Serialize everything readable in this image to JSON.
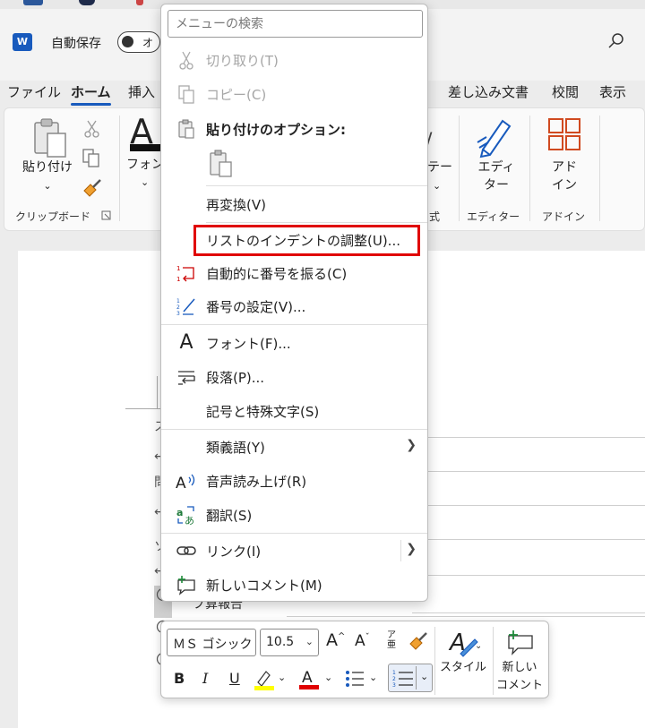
{
  "titlebar": {
    "app_logo": "W",
    "autosave_label": "自動保存",
    "autosave_toggle_text": "オ"
  },
  "tabs": [
    {
      "label": "ファイル",
      "active": false
    },
    {
      "label": "ホーム",
      "active": true
    },
    {
      "label": "挿入",
      "active": false
    },
    {
      "label": "差し込み文書",
      "active": false
    },
    {
      "label": "校閲",
      "active": false
    },
    {
      "label": "表示",
      "active": false
    }
  ],
  "ribbon": {
    "paste_label": "貼り付け",
    "clipboard_group": "クリップボード",
    "font_label": "フォン",
    "style_partial_label": "テー",
    "style_group_partial": "式",
    "editor_label_1": "エディ",
    "editor_label_2": "ター",
    "editor_group": "エディター",
    "addin_label_1": "アド",
    "addin_label_2": "イン",
    "addin_group": "アドイン"
  },
  "context_menu": {
    "search_placeholder": "メニューの検索",
    "items": [
      {
        "label": "切り取り(T)",
        "icon": "scissors-icon",
        "disabled": true
      },
      {
        "label": "コピー(C)",
        "icon": "copy-icon",
        "disabled": true
      },
      {
        "label": "貼り付けのオプション:",
        "icon": "clipboard-icon",
        "disabled": false
      },
      {
        "label": "再変換(V)",
        "icon": "",
        "disabled": false
      },
      {
        "label": "リストのインデントの調整(U)...",
        "icon": "",
        "disabled": false
      },
      {
        "label": "自動的に番号を振る(C)",
        "icon": "auto-number-icon",
        "disabled": false
      },
      {
        "label": "番号の設定(V)...",
        "icon": "numbering-icon",
        "disabled": false
      },
      {
        "label": "フォント(F)...",
        "icon": "font-icon",
        "disabled": false
      },
      {
        "label": "段落(P)...",
        "icon": "paragraph-icon",
        "disabled": false
      },
      {
        "label": "記号と特殊文字(S)",
        "icon": "",
        "disabled": false
      },
      {
        "label": "類義語(Y)",
        "icon": "",
        "disabled": false
      },
      {
        "label": "音声読み上げ(R)",
        "icon": "read-aloud-icon",
        "disabled": false
      },
      {
        "label": "翻訳(S)",
        "icon": "translate-icon",
        "disabled": false
      },
      {
        "label": "リンク(I)",
        "icon": "link-icon",
        "disabled": false
      },
      {
        "label": "新しいコメント(M)",
        "icon": "new-comment-icon",
        "disabled": false
      }
    ]
  },
  "mini_toolbar": {
    "font_name": "ＭＳ ゴシック",
    "font_size": "10.5",
    "bold": "B",
    "italic": "I",
    "underline": "U",
    "styles_label": "スタイル",
    "new_comment_label_1": "新しい",
    "new_comment_label_2": "コメント",
    "highlight_color": "#ffff00",
    "font_color": "#e00000"
  },
  "document": {
    "visible_chars": [
      "ス",
      "←",
      "問",
      "←",
      "ソ",
      "←"
    ],
    "partial_text": "ブ算報告"
  },
  "colors": {
    "accent": "#185abd",
    "highlight_box": "#e00000"
  }
}
